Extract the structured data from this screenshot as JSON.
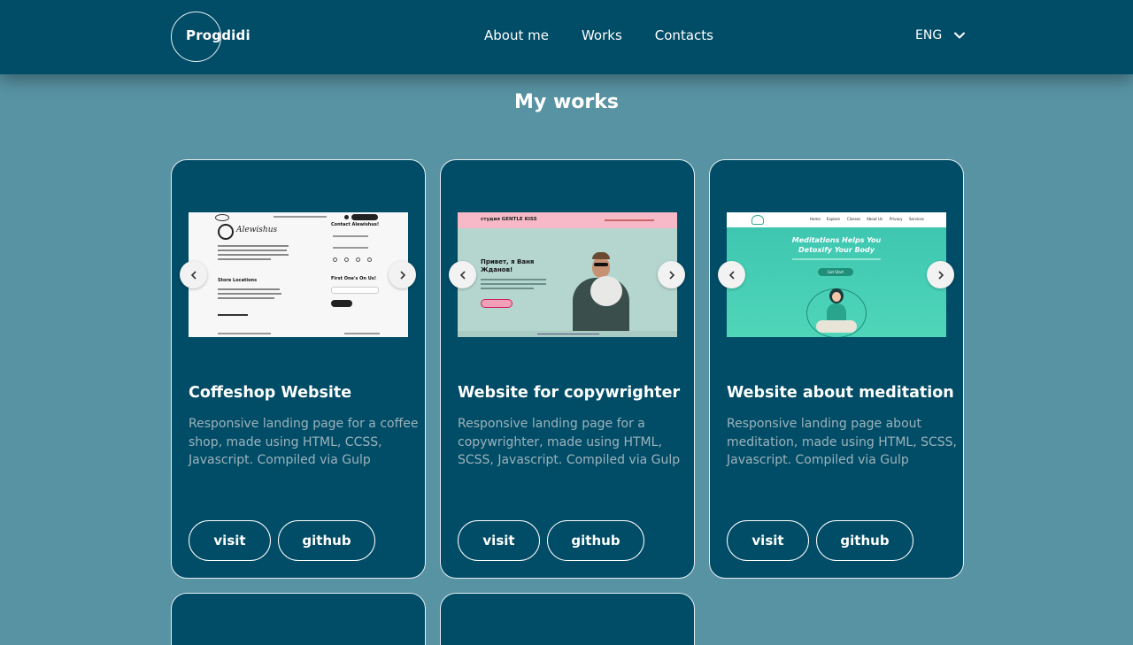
{
  "header": {
    "logo": "Progdidi",
    "nav": [
      "About me",
      "Works",
      "Contacts"
    ],
    "language": "ENG"
  },
  "section_title": "My works",
  "cards": [
    {
      "title": "Coffeshop Website",
      "description": "Responsive landing page for a coffee shop, made using HTML, CCSS, Javascript. Compiled via Gulp",
      "visit_label": "visit",
      "github_label": "github",
      "preview": {
        "brand": "Alewishus",
        "contact_title": "Contact Alewishus!",
        "store_title": "Store Locations",
        "cta_title": "First One's On Us!"
      }
    },
    {
      "title": "Website for copywrighter",
      "description": "Responsive landing page for a copywrighter, made using HTML, SCSS, Javascript. Compiled via Gulp",
      "visit_label": "visit",
      "github_label": "github",
      "preview": {
        "brand": "студия GENTLE KISS",
        "headline": "Привет, я Ваня Жданов!"
      }
    },
    {
      "title": "Website about meditation",
      "description": "Responsive landing page about meditation, made using HTML, SCSS, Javascript. Compiled via Gulp",
      "visit_label": "visit",
      "github_label": "github",
      "preview": {
        "headline": "Meditations Helps You Detoxify Your Body",
        "button": "Get Start",
        "nav": [
          "Home",
          "Explore",
          "Classes",
          "About Us",
          "Privacy",
          "Services"
        ]
      }
    }
  ],
  "colors": {
    "background": "#5893a3",
    "card": "#014c66",
    "header": "#014c66"
  }
}
